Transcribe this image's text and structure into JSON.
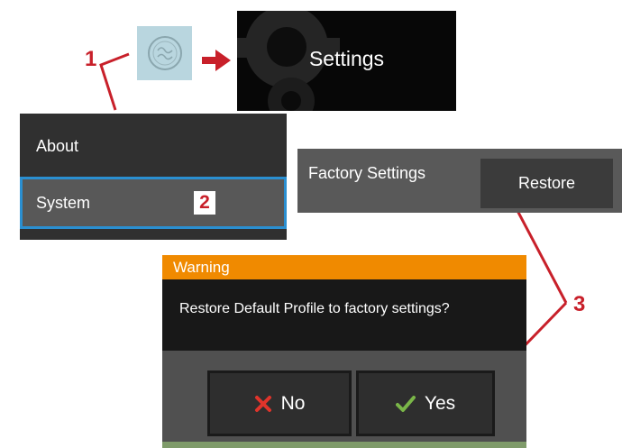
{
  "callouts": {
    "one": "1",
    "two": "2",
    "three": "3"
  },
  "settings_tile": {
    "label": "Settings"
  },
  "menu": {
    "items": [
      {
        "label": "About"
      },
      {
        "label": "System"
      }
    ]
  },
  "factory": {
    "label": "Factory Settings",
    "restore_label": "Restore"
  },
  "warning_dialog": {
    "title": "Warning",
    "message": "Restore Default Profile to factory settings?",
    "no_label": "No",
    "yes_label": "Yes"
  },
  "colors": {
    "accent_blue": "#2a8fd1",
    "warning_orange": "#f08a00",
    "callout_red": "#c8202a",
    "yes_check_green": "#7ab648",
    "no_x_red": "#e0342b"
  },
  "icons": [
    "ge-logo-icon",
    "gear-icon",
    "arrow-right-icon",
    "x-icon",
    "check-icon"
  ]
}
